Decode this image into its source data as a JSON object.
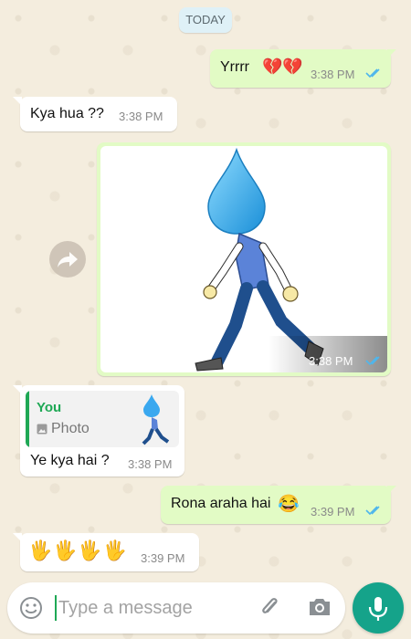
{
  "chat": {
    "date_label": "TODAY",
    "messages": [
      {
        "direction": "out",
        "text": "Yrrrr",
        "emoji": "💔💔",
        "time": "3:38 PM",
        "read": true
      },
      {
        "direction": "in",
        "text": "Kya hua ??",
        "time": "3:38 PM"
      },
      {
        "direction": "out",
        "type": "image",
        "image_desc": "water-drop-head-walking-man",
        "time": "3:38 PM",
        "read": true
      },
      {
        "direction": "in",
        "reply_to": {
          "author": "You",
          "kind_label": "Photo"
        },
        "text": "Ye kya hai ?",
        "time": "3:38 PM"
      },
      {
        "direction": "out",
        "text": "Rona araha hai",
        "emoji": "😂",
        "time": "3:39 PM",
        "read": true
      },
      {
        "direction": "in",
        "text": "🖐🖐🖐🖐",
        "time": "3:39 PM"
      }
    ]
  },
  "composer": {
    "placeholder": "Type a message"
  },
  "colors": {
    "outgoing_bubble": "#e2fbc5",
    "incoming_bubble": "#ffffff",
    "read_ticks": "#4fb6ec",
    "accent": "#15a38a",
    "reply_bar": "#1fa855"
  }
}
